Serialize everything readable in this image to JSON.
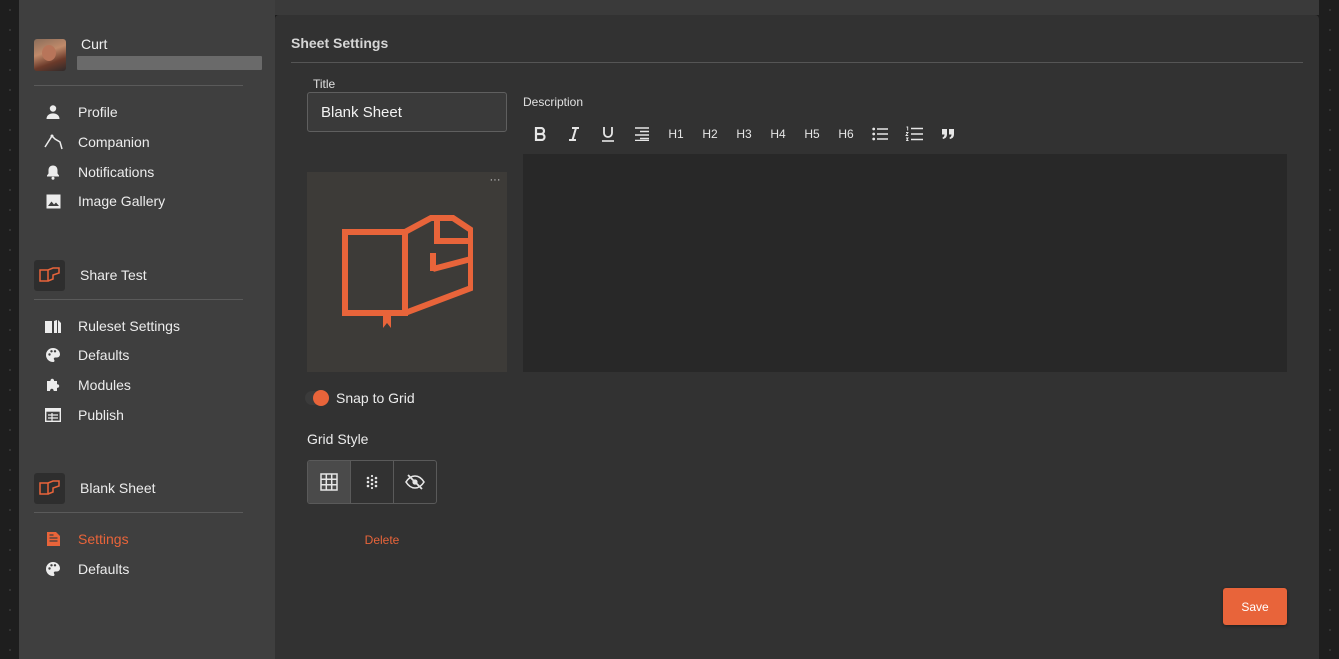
{
  "sidebar": {
    "user": {
      "name": "Curt"
    },
    "account_items": [
      {
        "label": "Profile",
        "icon": "person-icon"
      },
      {
        "label": "Companion",
        "icon": "companion-icon"
      },
      {
        "label": "Notifications",
        "icon": "bell-icon"
      },
      {
        "label": "Image Gallery",
        "icon": "image-icon"
      }
    ],
    "ruleset": {
      "name": "Share Test",
      "items": [
        {
          "label": "Ruleset Settings",
          "icon": "book-settings-icon"
        },
        {
          "label": "Defaults",
          "icon": "palette-icon"
        },
        {
          "label": "Modules",
          "icon": "puzzle-icon"
        },
        {
          "label": "Publish",
          "icon": "publish-icon"
        }
      ]
    },
    "sheet": {
      "name": "Blank Sheet",
      "items": [
        {
          "label": "Settings",
          "icon": "document-icon",
          "active": true
        },
        {
          "label": "Defaults",
          "icon": "palette-icon"
        }
      ]
    }
  },
  "main": {
    "title": "Sheet Settings",
    "title_field": {
      "label": "Title",
      "value": "Blank Sheet"
    },
    "snap_to_grid": {
      "label": "Snap to Grid",
      "on": true
    },
    "grid_style": {
      "label": "Grid Style",
      "options": [
        "grid-icon",
        "dots-icon",
        "eye-off-icon"
      ],
      "selected": 0
    },
    "delete_label": "Delete",
    "description": {
      "label": "Description",
      "toolbar": [
        "H1",
        "H2",
        "H3",
        "H4",
        "H5",
        "H6"
      ]
    },
    "save_label": "Save"
  },
  "colors": {
    "accent": "#e8643a",
    "sidebar_bg": "#3f3f3f",
    "panel_bg": "#323232",
    "editor_bg": "#282828"
  }
}
